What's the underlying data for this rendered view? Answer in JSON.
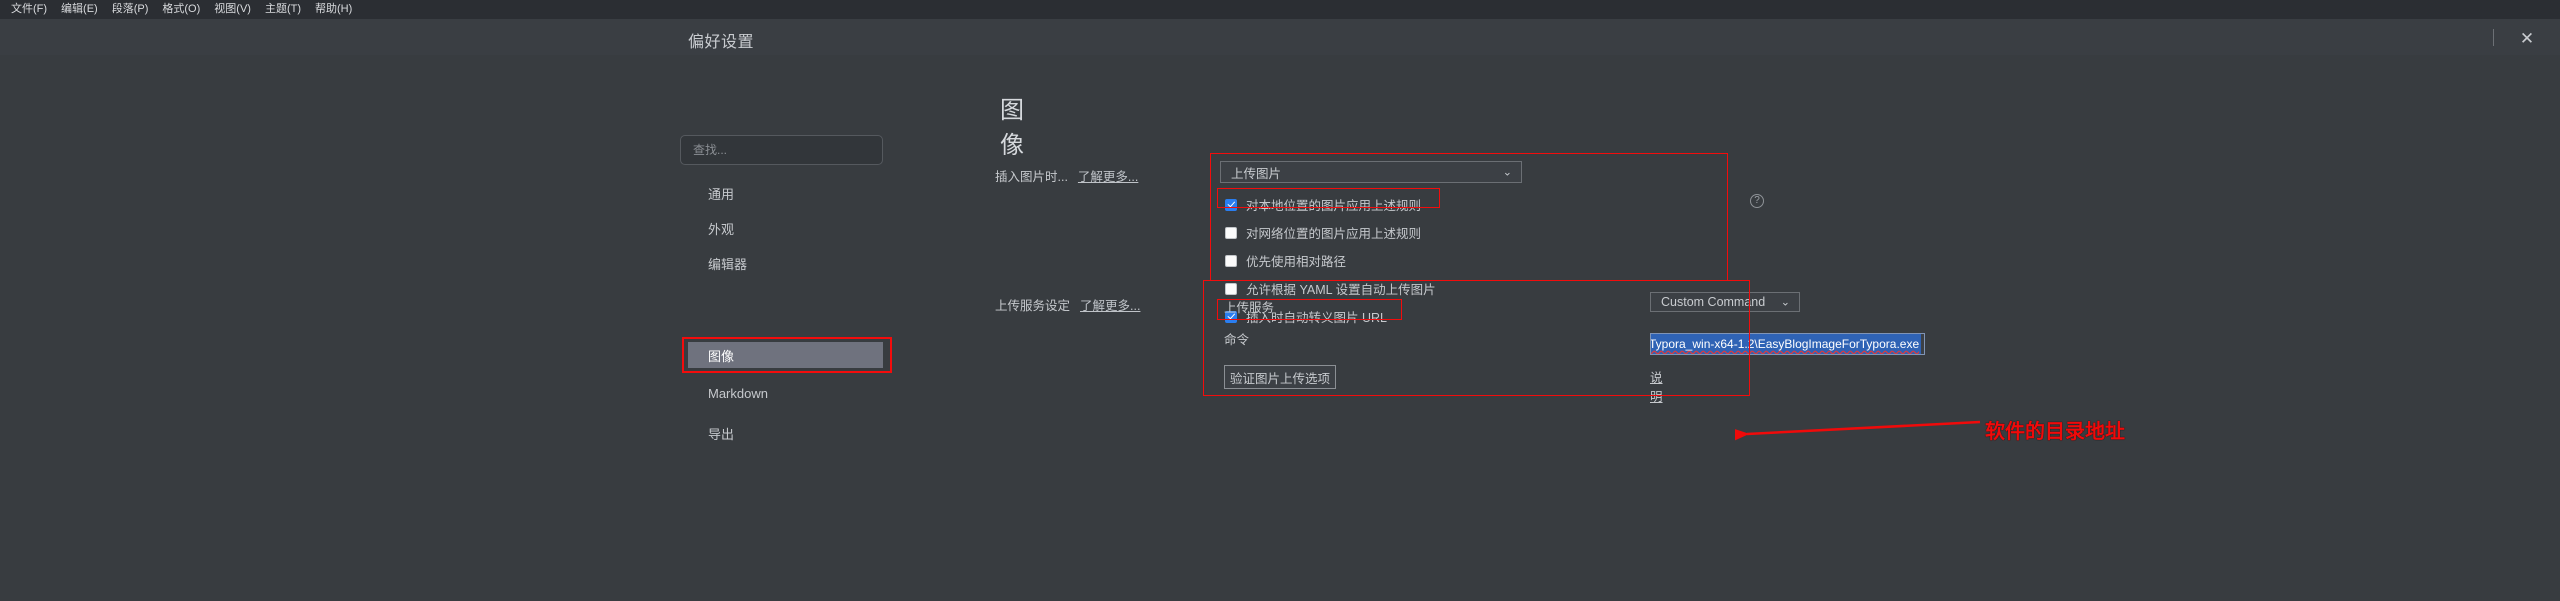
{
  "menubar": {
    "items": [
      {
        "label": "文件(F)"
      },
      {
        "label": "编辑(E)"
      },
      {
        "label": "段落(P)"
      },
      {
        "label": "格式(O)"
      },
      {
        "label": "视图(V)"
      },
      {
        "label": "主题(T)"
      },
      {
        "label": "帮助(H)"
      }
    ]
  },
  "titlebar": {
    "title": "偏好设置",
    "close_label": "✕"
  },
  "sidebar": {
    "search_placeholder": "查找...",
    "search_value": "",
    "items": [
      {
        "label": "通用",
        "selected": false
      },
      {
        "label": "外观",
        "selected": false
      },
      {
        "label": "编辑器",
        "selected": false
      },
      {
        "label": "图像",
        "selected": true
      },
      {
        "label": "Markdown",
        "selected": false
      },
      {
        "label": "导出",
        "selected": false
      }
    ]
  },
  "main": {
    "section_title": "图像",
    "insert_image": {
      "label": "插入图片时...",
      "learn_more": "了解更多...",
      "dropdown_value": "上传图片",
      "chevron": "⌄",
      "checkboxes": [
        {
          "label": "对本地位置的图片应用上述规则",
          "checked": true
        },
        {
          "label": "对网络位置的图片应用上述规则",
          "checked": false
        },
        {
          "label": "优先使用相对路径",
          "checked": false
        },
        {
          "label": "允许根据 YAML 设置自动上传图片",
          "checked": false
        },
        {
          "label": "插入时自动转义图片 URL",
          "checked": true
        }
      ],
      "help_icon": "?"
    },
    "upload_service": {
      "label": "上传服务设定",
      "learn_more": "了解更多...",
      "service_field_label": "上传服务",
      "service_value": "Custom Command",
      "chevron": "⌄",
      "command_field_label": "命令",
      "command_value": "Typora_win-x64-1.2\\EasyBlogImageForTypora.exe",
      "verify_button": "验证图片上传选项",
      "description_link": "说明"
    }
  },
  "annotation": {
    "text": "软件的目录地址",
    "color": "#f00a0a"
  }
}
